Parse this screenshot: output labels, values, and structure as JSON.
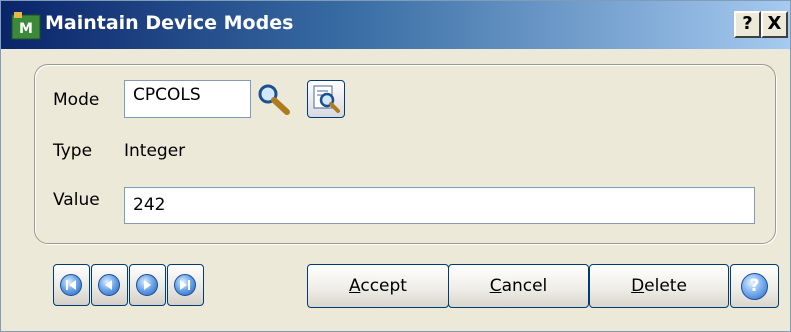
{
  "window": {
    "title": "Maintain Device Modes",
    "help_glyph": "?",
    "close_glyph": "X"
  },
  "form": {
    "mode_label": "Mode",
    "mode_value": "CPCOLS",
    "type_label": "Type",
    "type_value": "Integer",
    "value_label": "Value",
    "value_value": "242"
  },
  "buttons": {
    "accept_hotkey": "A",
    "accept_rest": "ccept",
    "cancel_hotkey": "C",
    "cancel_rest": "ancel",
    "delete_hotkey": "D",
    "delete_rest": "elete",
    "help_glyph": "?"
  },
  "icons": {
    "app": "app-icon",
    "lookup": "magnifier-icon",
    "lookup_button": "lookup-list-icon",
    "nav": [
      "first-record-icon",
      "previous-record-icon",
      "next-record-icon",
      "last-record-icon"
    ]
  },
  "colors": {
    "title_gradient_start": "#0a246a",
    "title_gradient_end": "#a6caf0",
    "window_bg": "#ece9d8",
    "field_border": "#7f9db9"
  }
}
